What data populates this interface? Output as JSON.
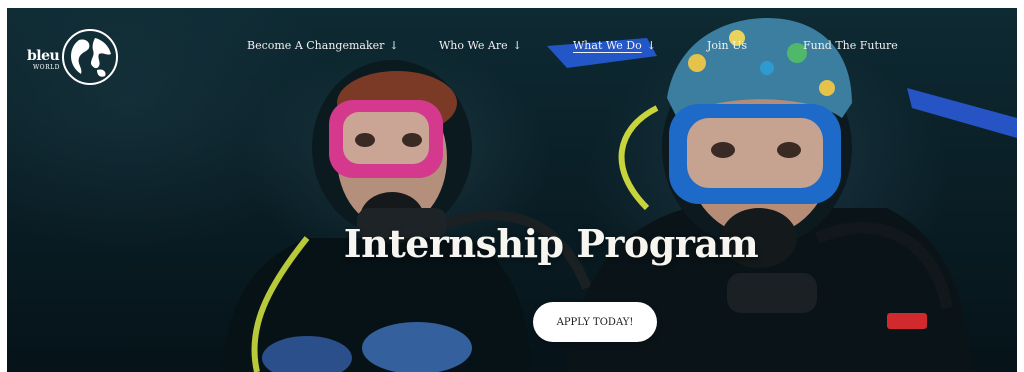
{
  "logo": {
    "wordmark": "bleu",
    "sub": "WORLD"
  },
  "nav": {
    "items": [
      {
        "label": "Become A Changemaker",
        "has_dropdown": true,
        "active": false
      },
      {
        "label": "Who We Are",
        "has_dropdown": true,
        "active": false
      },
      {
        "label": "What We Do",
        "has_dropdown": true,
        "active": true
      },
      {
        "label": "Join Us",
        "has_dropdown": false,
        "active": false
      },
      {
        "label": "Fund The Future",
        "has_dropdown": false,
        "active": false
      }
    ],
    "dropdown_glyph": "↓"
  },
  "hero": {
    "title": "Internship Program",
    "cta_label": "APPLY TODAY!"
  },
  "colors": {
    "background": "#0a1f27",
    "text": "#f2f2f2",
    "cta_bg": "#ffffff",
    "pink_mask": "#e0479c",
    "blue_mask": "#1f6fd0"
  },
  "icons": {
    "logo_globe": "globe-icon",
    "dropdown": "arrow-down-icon"
  }
}
